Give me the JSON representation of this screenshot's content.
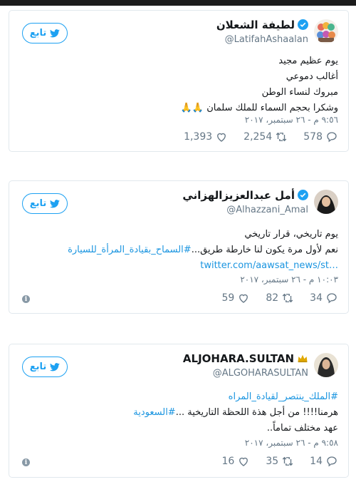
{
  "follow_label": "تابع",
  "tweets": [
    {
      "name": "لطيفة الشعلان",
      "handle": "@LatifahAshaalan",
      "lines": [
        "يوم عظيم مجيد",
        "أغالب دموعي",
        "مبروك لنساء الوطن",
        "وشكرا بحجم السماء للملك سلمان 🙏🙏"
      ],
      "time": "٩:٥٦ م - ٢٦ سبتمبر، ٢٠١٧",
      "replies": "578",
      "retweets": "2,254",
      "likes": "1,393"
    },
    {
      "name": "أمل عبدالعزيزالهزاني",
      "handle": "@Alhazzani_Amal",
      "line1": "يوم تاريخي، قرار تاريخي",
      "line2_text": "نعم لأول مرة يكون لنا خارطة طريق...",
      "line2_tag": "#السماح_بقيادة_المرأة_للسيارة",
      "link": "twitter.com/aawsat_news/st…",
      "time": "١٠:٠٣ م - ٢٦ سبتمبر، ٢٠١٧",
      "replies": "34",
      "retweets": "82",
      "likes": "59"
    },
    {
      "name": "ALJOHARA.SULTAN",
      "handle": "@ALGOHARASULTAN",
      "line1_tag": "#الملك_ينتصر_لقيادة_المراه",
      "line2_text": "هرمنا!!!! من أجل هذة اللحظة التاريخية ...",
      "line2_tag": "#السعودية",
      "line3": "عهد مختلف تماماً..",
      "time": "٩:٥٨ م - ٢٦ سبتمبر، ٢٠١٧",
      "replies": "14",
      "retweets": "35",
      "likes": "16"
    }
  ],
  "colors": {
    "accent": "#1da1f2",
    "link": "#1b95e0",
    "muted": "#657786",
    "border": "#e1e8ed"
  },
  "icons": [
    "twitter-bird-icon",
    "verified-badge-icon",
    "reply-icon",
    "retweet-icon",
    "like-icon",
    "info-icon",
    "crown-icon"
  ]
}
